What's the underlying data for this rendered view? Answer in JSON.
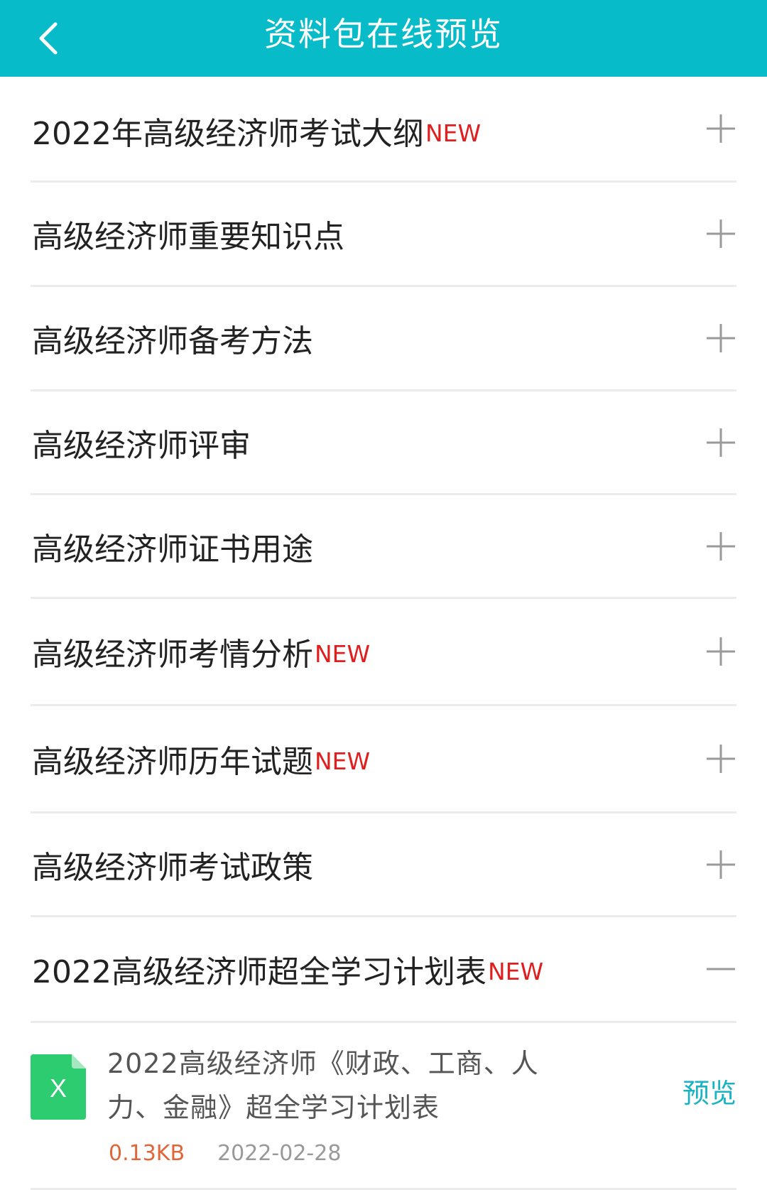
{
  "header": {
    "title": "资料包在线预览",
    "back_icon": "chevron-left-icon",
    "background_color": "#07bcc8"
  },
  "accent": {
    "new_badge_color": "#e01e1e",
    "preview_color": "#1ab3c3",
    "file_size_color": "#e0663a",
    "excel_icon_color": "#2ecc71"
  },
  "sections": [
    {
      "label": "2022年高级经济师考试大纲",
      "badge": "NEW",
      "toggle_icon": "plus-icon",
      "expanded": false
    },
    {
      "label": "高级经济师重要知识点",
      "badge": "",
      "toggle_icon": "plus-icon",
      "expanded": false
    },
    {
      "label": "高级经济师备考方法",
      "badge": "",
      "toggle_icon": "plus-icon",
      "expanded": false
    },
    {
      "label": "高级经济师评审",
      "badge": "",
      "toggle_icon": "plus-icon",
      "expanded": false
    },
    {
      "label": "高级经济师证书用途",
      "badge": "",
      "toggle_icon": "plus-icon",
      "expanded": false
    },
    {
      "label": "高级经济师考情分析",
      "badge": "NEW",
      "toggle_icon": "plus-icon",
      "expanded": false
    },
    {
      "label": "高级经济师历年试题",
      "badge": "NEW",
      "toggle_icon": "plus-icon",
      "expanded": false
    },
    {
      "label": "高级经济师考试政策",
      "badge": "",
      "toggle_icon": "plus-icon",
      "expanded": false
    },
    {
      "label": "2022高级经济师超全学习计划表",
      "badge": "NEW",
      "toggle_icon": "minus-icon",
      "expanded": true
    }
  ],
  "files": [
    {
      "icon": "excel-file-icon",
      "icon_letter": "X",
      "name": "2022高级经济师《财政、工商、人力、金融》超全学习计划表",
      "size": "0.13KB",
      "date": "2022-02-28",
      "action_label": "预览"
    }
  ]
}
